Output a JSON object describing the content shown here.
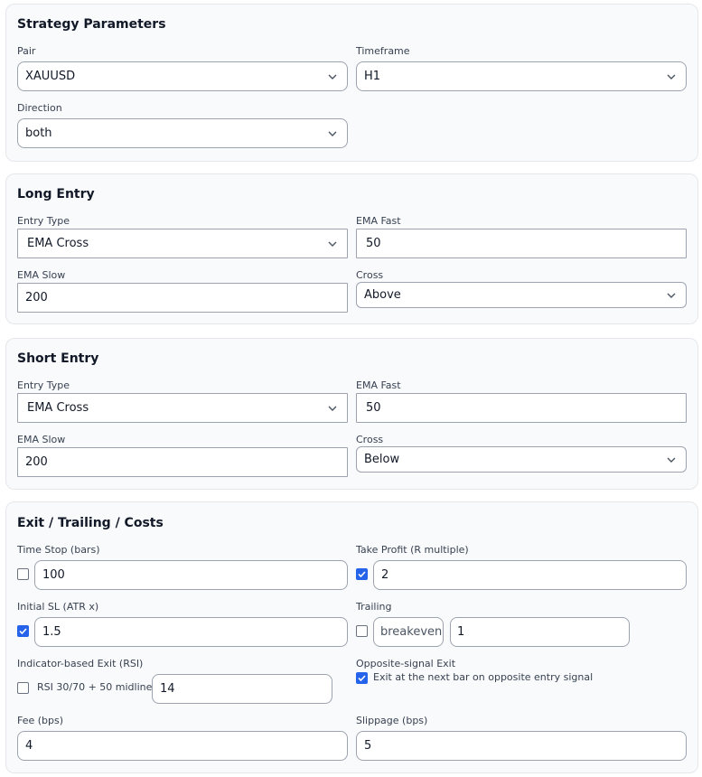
{
  "strategy": {
    "title": "Strategy Parameters",
    "pair_label": "Pair",
    "pair_value": "XAUUSD",
    "timeframe_label": "Timeframe",
    "timeframe_value": "H1",
    "direction_label": "Direction",
    "direction_value": "both"
  },
  "long_entry": {
    "title": "Long Entry",
    "entry_type_label": "Entry Type",
    "entry_type_value": "EMA Cross",
    "ema_fast_label": "EMA Fast",
    "ema_fast_value": "50",
    "ema_slow_label": "EMA Slow",
    "ema_slow_value": "200",
    "cross_label": "Cross",
    "cross_value": "Above"
  },
  "short_entry": {
    "title": "Short Entry",
    "entry_type_label": "Entry Type",
    "entry_type_value": "EMA Cross",
    "ema_fast_label": "EMA Fast",
    "ema_fast_value": "50",
    "ema_slow_label": "EMA Slow",
    "ema_slow_value": "200",
    "cross_label": "Cross",
    "cross_value": "Below"
  },
  "exit": {
    "title": "Exit / Trailing / Costs",
    "time_stop_label": "Time Stop (bars)",
    "time_stop_checked": false,
    "time_stop_value": "100",
    "take_profit_label": "Take Profit (R multiple)",
    "take_profit_checked": true,
    "take_profit_value": "2",
    "initial_sl_label": "Initial SL (ATR x)",
    "initial_sl_checked": true,
    "initial_sl_value": "1.5",
    "trailing_label": "Trailing",
    "trailing_checked": false,
    "trailing_mode": "breakeven",
    "trailing_value": "1",
    "rsi_exit_label": "Indicator-based Exit (RSI)",
    "rsi_checked": false,
    "rsi_option_text": "RSI 30/70 + 50 midline",
    "rsi_value": "14",
    "opposite_label": "Opposite-signal Exit",
    "opposite_checked": true,
    "opposite_text": "Exit at the next bar on opposite entry signal",
    "fee_label": "Fee (bps)",
    "fee_value": "4",
    "slippage_label": "Slippage (bps)",
    "slippage_value": "5"
  },
  "colors": {
    "accent": "#2563eb",
    "border": "#9ca3af",
    "card_bg": "#f9fafb"
  },
  "icons": {
    "dropdown": "chevron-down-icon",
    "check": "check-icon"
  }
}
